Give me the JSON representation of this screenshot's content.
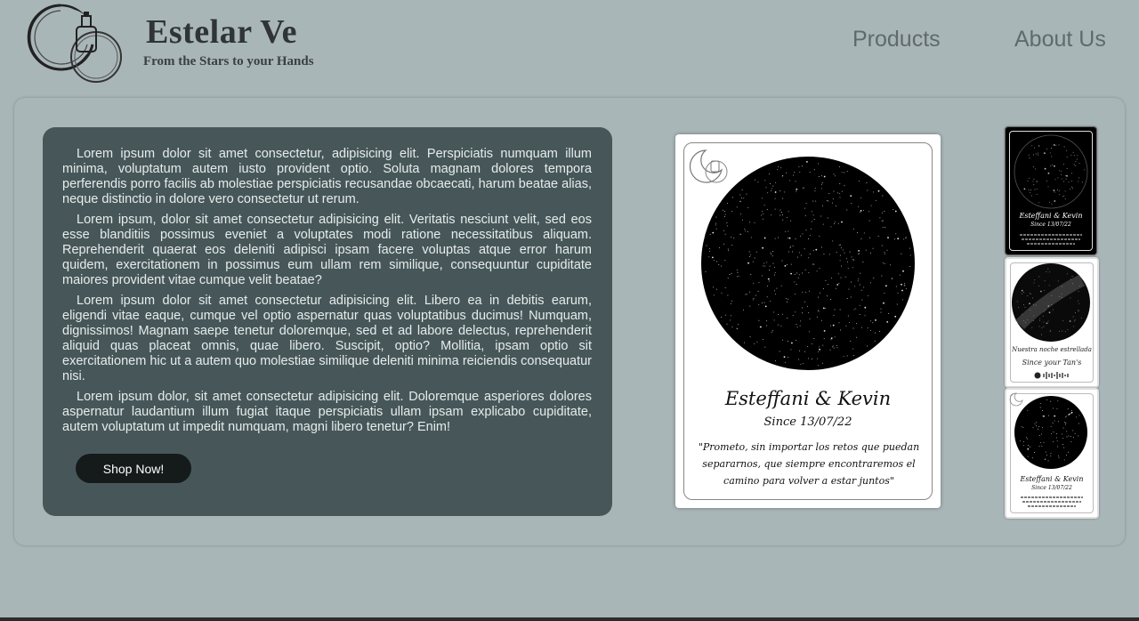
{
  "brand": {
    "title": "Estelar Ve",
    "tagline": "From the Stars to your Hands",
    "logo_icon": "moon-perfume-logo-icon"
  },
  "nav": {
    "items": [
      {
        "label": "Products"
      },
      {
        "label": "About Us"
      }
    ]
  },
  "content": {
    "paragraphs": [
      "Lorem ipsum dolor sit amet consectetur, adipisicing elit. Perspiciatis numquam illum minima, voluptatum autem iusto provident optio. Soluta magnam dolores tempora perferendis porro facilis ab molestiae perspiciatis recusandae obcaecati, harum beatae alias, neque distinctio in dolore vero consectetur ut rerum.",
      "Lorem ipsum, dolor sit amet consectetur adipisicing elit. Veritatis nesciunt velit, sed eos esse blanditiis possimus eveniet a voluptates modi ratione necessitatibus aliquam. Reprehenderit quaerat eos deleniti adipisci ipsam facere voluptas atque error harum quidem, exercitationem in possimus eum ullam rem similique, consequuntur cupiditate maiores provident vitae cumque velit beatae?",
      "Lorem ipsum dolor sit amet consectetur adipisicing elit. Libero ea in debitis earum, eligendi vitae eaque, cumque vel optio aspernatur quas voluptatibus ducimus! Numquam, dignissimos! Magnam saepe tenetur doloremque, sed et ad labore delectus, reprehenderit aliquid quas placeat omnis, quae libero. Suscipit, optio? Mollitia, ipsam optio sit exercitationem hic ut a autem quo molestiae similique deleniti minima reiciendis consequatur nisi.",
      "Lorem ipsum dolor, sit amet consectetur adipisicing elit. Doloremque asperiores dolores aspernatur laudantium illum fugiat itaque perspiciatis ullam ipsam explicabo cupiditate, autem voluptatum ut impedit numquam, magni libero tenetur? Enim!"
    ],
    "cta_label": "Shop Now!"
  },
  "preview": {
    "names": "Esteffani & Kevin",
    "since": "Since 13/07/22",
    "quote": "\"Prometo, sin importar los retos que puedan separarnos, que siempre encontraremos el camino para volver a estar juntos\""
  },
  "thumbnails": [
    {
      "style": "black",
      "names": "Esteffani & Kevin",
      "since": "Since 13/07/22"
    },
    {
      "style": "white-milkyway",
      "caption": "Nuestra noche estrellada",
      "sub": "Since your Tan's"
    },
    {
      "style": "white",
      "names": "Esteffani & Kevin",
      "since": "Since 13/07/22"
    }
  ],
  "colors": {
    "background": "#a9b6b8",
    "panel": "#475759",
    "panel_text": "#e6ecec",
    "button": "#151a1b",
    "nav_text": "#5f6a6d"
  }
}
